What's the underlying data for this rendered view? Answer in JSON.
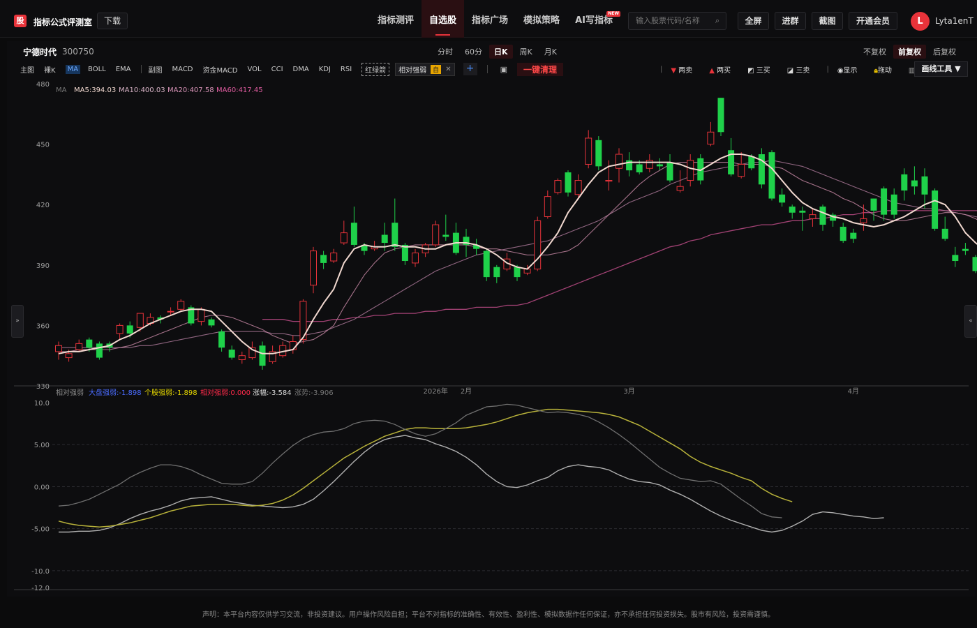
{
  "header": {
    "logo_char": "股",
    "brand": "指标公式评测室",
    "download": "下载",
    "nav": [
      "指标测评",
      "自选股",
      "指标广场",
      "模拟策略",
      "AI写指标"
    ],
    "nav_active": 1,
    "new_badge": "NEW",
    "search_placeholder": "输入股票代码/名称",
    "buttons": [
      "全屏",
      "进群",
      "截图",
      "开通会员"
    ],
    "avatar": "L",
    "user": "Lyta1enT"
  },
  "stock": {
    "name": "宁德时代",
    "code": "300750"
  },
  "periods": [
    "分时",
    "60分",
    "日K",
    "周K",
    "月K"
  ],
  "period_active": 2,
  "adjust": [
    "不复权",
    "前复权",
    "后复权"
  ],
  "adjust_active": 1,
  "toolbar": {
    "main_label": "主图",
    "main_items": [
      "裸K",
      "MA",
      "BOLL",
      "EMA"
    ],
    "main_active": 1,
    "sub_label": "副图",
    "sub_items": [
      "MACD",
      "资金MACD",
      "VOL",
      "CCI",
      "DMA",
      "KDJ",
      "RSI"
    ],
    "red_green_arrow": "红绿箭",
    "rel_strength": "相对强弱",
    "self_tag": "自",
    "clear_all": "一键清理"
  },
  "right_tools": {
    "items": [
      "两卖",
      "两买",
      "三买",
      "三卖",
      "显示",
      "拖动",
      "清空"
    ],
    "draw_tool": "画线工具 ▼"
  },
  "ma_legend": {
    "label": "MA",
    "ma5": "MA5:394.03",
    "ma10": "MA10:400.03",
    "ma20": "MA20:407.58",
    "ma60": "MA60:417.45"
  },
  "sub_legend": {
    "label": "相对强弱",
    "market": "大盘强弱:-1.898",
    "stock": "个股强弱:-1.898",
    "relative": "相对强弱:0.000",
    "change": "涨幅:-3.584",
    "trend": "涨势:-3.906"
  },
  "colors": {
    "up": "#e8333a",
    "down": "#1fd14a",
    "ma5": "#f2d9d0",
    "ma10": "#b77d98",
    "ma20": "#a0708e",
    "ma60": "#b3487f",
    "market": "#4a6cff",
    "stock": "#e6d800",
    "rel": "#ff2a4a",
    "line_a": "#b0b0b0",
    "line_b": "#b8b23a",
    "line_c": "#6f6f6f"
  },
  "sidebar": {
    "left": "»",
    "right": "«"
  },
  "footer": "声明：本平台内容仅供学习交流，非投资建议。用户操作风险自担；平台不对指标的准确性、有效性、盈利性、模拟数据作任何保证，亦不承担任何投资损失。股市有风险，投资需谨慎。",
  "chart_data": [
    {
      "type": "candlestick",
      "ylim": [
        330,
        480
      ],
      "yticks": [
        480,
        450,
        420,
        390,
        360,
        330
      ],
      "time_labels": [
        {
          "index": 37,
          "label": "2026年"
        },
        {
          "index": 40,
          "label": "2月"
        },
        {
          "index": 56,
          "label": "3月"
        },
        {
          "index": 78,
          "label": "4月"
        }
      ],
      "candles": [
        [
          347,
          350,
          343,
          352
        ],
        [
          344,
          346,
          342,
          348
        ],
        [
          348,
          351,
          347,
          353
        ],
        [
          353,
          349,
          347,
          354
        ],
        [
          351,
          344,
          343,
          352
        ],
        [
          351,
          349,
          347,
          352
        ],
        [
          356,
          360,
          353,
          361
        ],
        [
          360,
          356,
          354,
          362
        ],
        [
          359,
          366,
          357,
          366
        ],
        [
          361,
          364,
          360,
          366
        ],
        [
          364,
          363,
          361,
          365
        ],
        [
          367,
          367,
          365,
          369
        ],
        [
          368,
          372,
          367,
          373
        ],
        [
          369,
          361,
          360,
          370
        ],
        [
          362,
          368,
          360,
          369
        ],
        [
          363,
          360,
          359,
          364
        ],
        [
          357,
          349,
          347,
          358
        ],
        [
          348,
          344,
          343,
          350
        ],
        [
          343,
          345,
          341,
          347
        ],
        [
          344,
          349,
          343,
          352
        ],
        [
          350,
          340,
          338,
          352
        ],
        [
          342,
          347,
          341,
          350
        ],
        [
          345,
          350,
          344,
          352
        ],
        [
          348,
          352,
          346,
          355
        ],
        [
          353,
          372,
          351,
          373
        ],
        [
          380,
          397,
          376,
          399
        ],
        [
          395,
          391,
          388,
          397
        ],
        [
          392,
          396,
          391,
          398
        ],
        [
          401,
          406,
          400,
          412
        ],
        [
          411,
          400,
          399,
          419
        ],
        [
          400,
          397,
          395,
          401
        ],
        [
          398,
          399,
          397,
          402
        ],
        [
          405,
          401,
          397,
          411
        ],
        [
          411,
          399,
          397,
          423
        ],
        [
          400,
          392,
          390,
          401
        ],
        [
          391,
          396,
          389,
          398
        ],
        [
          396,
          400,
          394,
          401
        ],
        [
          400,
          410,
          399,
          412
        ],
        [
          405,
          404,
          402,
          415
        ],
        [
          406,
          396,
          395,
          411
        ],
        [
          404,
          400,
          394,
          408
        ],
        [
          400,
          398,
          395,
          403
        ],
        [
          397,
          384,
          382,
          398
        ],
        [
          389,
          384,
          381,
          390
        ],
        [
          388,
          393,
          387,
          396
        ],
        [
          389,
          384,
          382,
          390
        ],
        [
          386,
          388,
          385,
          390
        ],
        [
          388,
          412,
          387,
          414
        ],
        [
          414,
          424,
          413,
          427
        ],
        [
          426,
          432,
          425,
          433
        ],
        [
          436,
          426,
          424,
          437
        ],
        [
          425,
          432,
          423,
          435
        ],
        [
          440,
          453,
          438,
          457
        ],
        [
          452,
          439,
          437,
          454
        ],
        [
          432,
          432,
          427,
          442
        ],
        [
          438,
          445,
          431,
          448
        ],
        [
          442,
          437,
          434,
          446
        ],
        [
          440,
          436,
          435,
          442
        ],
        [
          438,
          442,
          436,
          445
        ],
        [
          440,
          439,
          437,
          443
        ],
        [
          441,
          432,
          431,
          445
        ],
        [
          427,
          429,
          426,
          437
        ],
        [
          432,
          442,
          429,
          445
        ],
        [
          443,
          432,
          430,
          445
        ],
        [
          450,
          456,
          449,
          461
        ],
        [
          473,
          456,
          454,
          473
        ],
        [
          447,
          435,
          434,
          453
        ],
        [
          434,
          440,
          433,
          446
        ],
        [
          444,
          438,
          437,
          445
        ],
        [
          445,
          430,
          428,
          448
        ],
        [
          446,
          423,
          422,
          447
        ],
        [
          425,
          421,
          419,
          428
        ],
        [
          419,
          416,
          413,
          420
        ],
        [
          417,
          416,
          407,
          419
        ],
        [
          413,
          415,
          409,
          418
        ],
        [
          419,
          410,
          407,
          420
        ],
        [
          415,
          412,
          409,
          416
        ],
        [
          409,
          402,
          401,
          411
        ],
        [
          406,
          403,
          401,
          408
        ],
        [
          411,
          413,
          407,
          420
        ],
        [
          423,
          417,
          412,
          423
        ],
        [
          428,
          415,
          412,
          429
        ],
        [
          425,
          415,
          413,
          428
        ],
        [
          435,
          427,
          422,
          438
        ],
        [
          432,
          429,
          425,
          439
        ],
        [
          434,
          425,
          418,
          438
        ],
        [
          427,
          408,
          407,
          428
        ],
        [
          408,
          403,
          402,
          414
        ],
        [
          395,
          392,
          389,
          399
        ],
        [
          398,
          397,
          395,
          401
        ],
        [
          394,
          387,
          386,
          395
        ],
        [
          388,
          383,
          381,
          390
        ],
        [
          389,
          393,
          385,
          396
        ],
        [
          393,
          396,
          391,
          397
        ],
        [
          398,
          401,
          396,
          403
        ],
        [
          402,
          405,
          400,
          408
        ],
        [
          410,
          408,
          400,
          410
        ]
      ],
      "ma5": [
        346,
        347,
        347,
        348,
        349,
        350,
        353,
        355,
        358,
        361,
        363,
        365,
        367,
        368,
        368,
        367,
        362,
        357,
        352,
        348,
        346,
        346,
        347,
        348,
        354,
        363,
        371,
        378,
        391,
        398,
        400,
        399,
        399,
        400,
        399,
        399,
        398,
        398,
        400,
        401,
        401,
        400,
        398,
        395,
        391,
        389,
        388,
        393,
        399,
        406,
        416,
        423,
        430,
        436,
        439,
        440,
        441,
        441,
        441,
        441,
        441,
        440,
        438,
        437,
        440,
        443,
        445,
        445,
        444,
        442,
        438,
        432,
        426,
        421,
        418,
        416,
        414,
        413,
        411,
        410,
        409,
        410,
        412,
        414,
        417,
        420,
        422,
        420,
        414,
        406,
        401,
        397,
        393,
        391,
        391,
        393,
        395
      ],
      "ma10": [
        347,
        347,
        348,
        348,
        348,
        348,
        349,
        350,
        352,
        354,
        356,
        358,
        360,
        362,
        364,
        365,
        365,
        364,
        362,
        360,
        358,
        355,
        353,
        351,
        352,
        353,
        356,
        360,
        369,
        377,
        385,
        391,
        396,
        398,
        399,
        400,
        400,
        400,
        400,
        400,
        400,
        399,
        398,
        398,
        397,
        396,
        395,
        395,
        395,
        396,
        397,
        400,
        405,
        410,
        415,
        420,
        425,
        430,
        434,
        437,
        440,
        441,
        441,
        441,
        441,
        441,
        441,
        440,
        440,
        440,
        439,
        438,
        435,
        432,
        430,
        428,
        426,
        423,
        421,
        418,
        415,
        413,
        412,
        412,
        413,
        414,
        415,
        416,
        416,
        415,
        413,
        410,
        406,
        402,
        399,
        396,
        395
      ],
      "ma20": [
        349,
        349,
        349,
        349,
        349,
        349,
        349,
        349,
        350,
        350,
        351,
        352,
        353,
        354,
        355,
        356,
        357,
        357,
        357,
        357,
        357,
        356,
        356,
        355,
        355,
        356,
        357,
        359,
        361,
        363,
        366,
        369,
        372,
        375,
        378,
        381,
        384,
        387,
        389,
        391,
        393,
        395,
        396,
        397,
        398,
        399,
        400,
        401,
        402,
        404,
        406,
        408,
        410,
        412,
        415,
        418,
        421,
        423,
        425,
        427,
        430,
        432,
        434,
        436,
        437,
        438,
        439,
        440,
        441,
        441,
        442,
        441,
        440,
        439,
        437,
        435,
        433,
        431,
        429,
        427,
        425,
        423,
        421,
        420,
        419,
        418,
        418,
        417,
        416,
        415,
        414,
        413,
        411,
        410,
        409,
        408,
        407
      ],
      "ma60": [
        null,
        null,
        null,
        null,
        null,
        null,
        null,
        null,
        null,
        null,
        null,
        null,
        null,
        null,
        null,
        null,
        null,
        null,
        null,
        null,
        363,
        363,
        363,
        362,
        362,
        362,
        362,
        363,
        363,
        364,
        364,
        365,
        365,
        366,
        366,
        366,
        367,
        367,
        368,
        368,
        368,
        369,
        369,
        369,
        370,
        370,
        371,
        373,
        375,
        377,
        379,
        381,
        383,
        385,
        387,
        389,
        391,
        393,
        395,
        397,
        399,
        400,
        402,
        403,
        405,
        406,
        407,
        408,
        409,
        410,
        410,
        411,
        412,
        412,
        413,
        413,
        414,
        415,
        415,
        416,
        416,
        417,
        417,
        417,
        417,
        417,
        417,
        417,
        417,
        417,
        417,
        417,
        417,
        417,
        417,
        417,
        417
      ]
    },
    {
      "type": "line",
      "ylim": [
        -12,
        10
      ],
      "yticks": [
        10,
        5,
        0,
        -5,
        -10,
        -12
      ],
      "ytick_labels": [
        "10.0",
        "5.00",
        "0.00",
        "-5.00",
        "-10.0",
        "-12.0"
      ],
      "series": [
        {
          "values": [
            -5.4,
            -5.4,
            -5.3,
            -5.3,
            -5.2,
            -4.9,
            -4.4,
            -3.8,
            -3.3,
            -2.9,
            -2.6,
            -2.2,
            -1.7,
            -1.4,
            -1.3,
            -1.2,
            -1.5,
            -1.8,
            -2.0,
            -2.2,
            -2.3,
            -2.4,
            -2.5,
            -2.4,
            -2.1,
            -1.5,
            -0.5,
            0.6,
            1.8,
            3.0,
            4.1,
            5.0,
            5.6,
            5.9,
            6.1,
            5.8,
            5.6,
            5.1,
            4.7,
            4.2,
            3.5,
            2.6,
            1.5,
            0.6,
            0.0,
            -0.1,
            0.2,
            0.7,
            1.1,
            1.9,
            2.4,
            2.6,
            2.4,
            2.3,
            2.0,
            1.4,
            0.9,
            0.6,
            0.5,
            0.2,
            -0.4,
            -0.9,
            -1.5,
            -2.2,
            -2.9,
            -3.5,
            -4.0,
            -4.4,
            -4.8,
            -5.2,
            -5.4,
            -5.2,
            -4.7,
            -4.1,
            -3.3,
            -3.0,
            -3.1,
            -3.3,
            -3.5,
            -3.6,
            -3.8,
            -3.7
          ]
        },
        {
          "values": [
            -4.1,
            -4.4,
            -4.6,
            -4.7,
            -4.8,
            -4.7,
            -4.5,
            -4.3,
            -4.0,
            -3.7,
            -3.3,
            -2.9,
            -2.6,
            -2.3,
            -2.2,
            -2.1,
            -2.1,
            -2.1,
            -2.2,
            -2.3,
            -2.2,
            -2.0,
            -1.6,
            -1.0,
            -0.2,
            0.7,
            1.6,
            2.5,
            3.4,
            4.1,
            4.8,
            5.4,
            6.0,
            6.4,
            6.8,
            7.0,
            7.0,
            6.9,
            6.9,
            6.9,
            7.0,
            7.2,
            7.4,
            7.7,
            8.1,
            8.5,
            8.8,
            9.0,
            9.2,
            9.2,
            9.1,
            9.0,
            8.9,
            8.8,
            8.6,
            8.3,
            7.8,
            7.3,
            6.6,
            5.9,
            5.2,
            4.5,
            3.6,
            2.9,
            2.4,
            2.0,
            1.6,
            1.1,
            0.7,
            -0.2,
            -0.9,
            -1.4,
            -1.8
          ]
        },
        {
          "values": [
            -2.3,
            -2.2,
            -1.9,
            -1.5,
            -0.9,
            -0.3,
            0.3,
            1.1,
            1.7,
            2.2,
            2.6,
            2.6,
            2.4,
            2.0,
            1.4,
            0.9,
            0.4,
            0.3,
            0.3,
            0.6,
            1.6,
            2.8,
            3.9,
            4.9,
            5.7,
            6.2,
            6.5,
            6.6,
            6.9,
            7.5,
            7.8,
            7.9,
            7.8,
            7.4,
            6.8,
            6.3,
            6.0,
            6.3,
            6.9,
            7.6,
            8.5,
            9.0,
            9.5,
            9.6,
            9.8,
            9.7,
            9.4,
            9.1,
            8.8,
            8.9,
            8.8,
            8.6,
            8.3,
            7.7,
            7.0,
            6.2,
            5.3,
            4.3,
            3.3,
            2.3,
            1.6,
            1.0,
            0.8,
            0.6,
            0.7,
            0.3,
            -0.6,
            -1.5,
            -2.3,
            -3.2,
            -3.6,
            -3.7
          ]
        }
      ]
    }
  ]
}
